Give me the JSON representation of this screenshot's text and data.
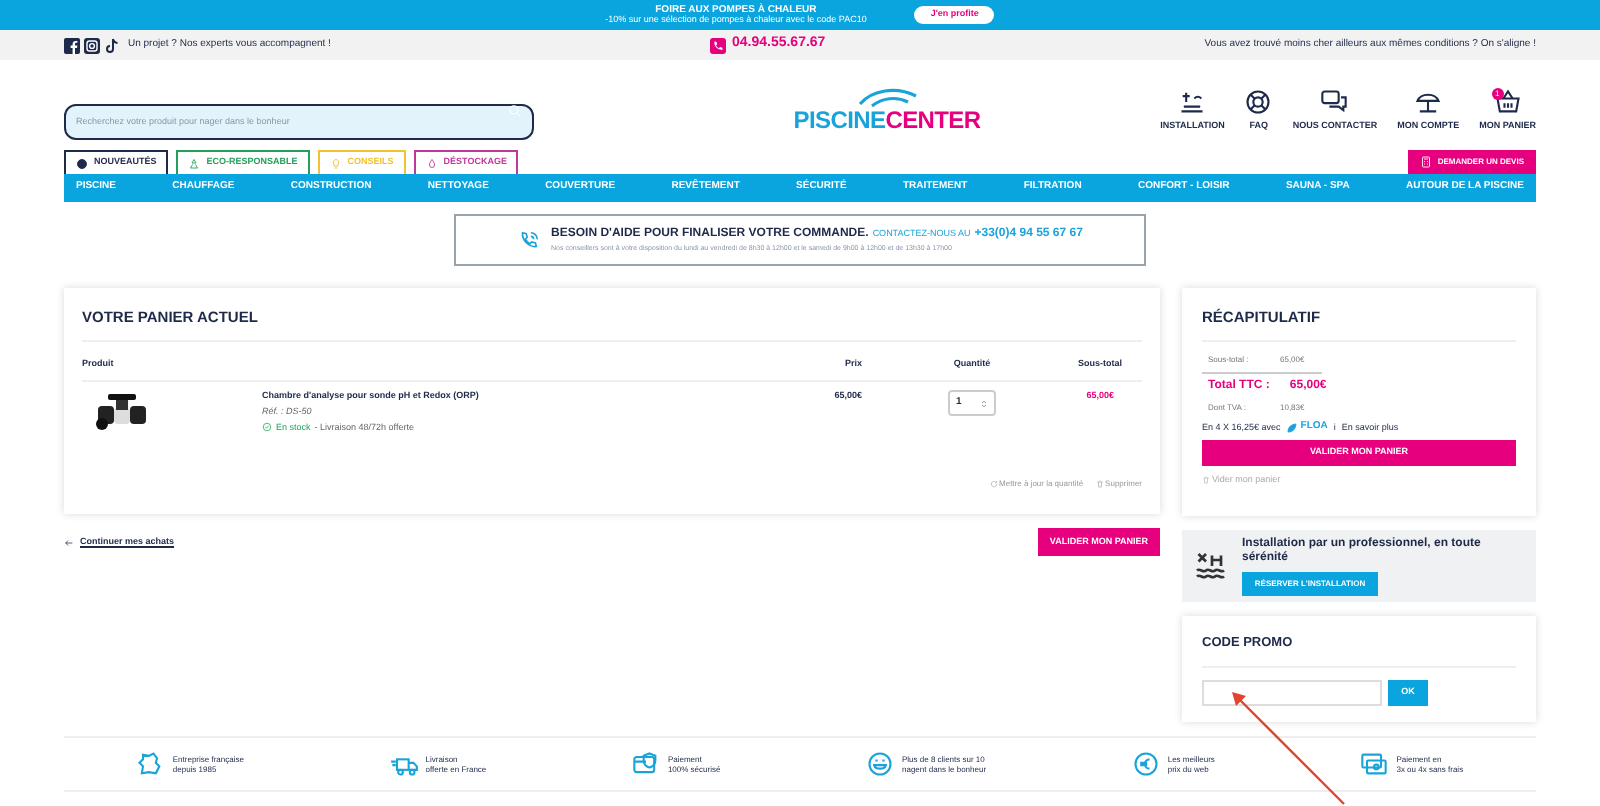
{
  "promo_banner": {
    "title": "FOIRE AUX POMPES À CHALEUR",
    "subtitle": "-10% sur une sélection de pompes à chaleur avec le code PAC10",
    "button": "J'en profite"
  },
  "top_bar": {
    "tagline": "Un projet ? Nos experts vous accompagnent !",
    "phone": "04.94.55.67.67",
    "price_match": "Vous avez trouvé moins cher ailleurs aux mêmes conditions ? On s'aligne !"
  },
  "header": {
    "search_placeholder": "Recherchez votre produit pour nager dans le bonheur",
    "logo": [
      "PISCINE",
      "CENTER"
    ],
    "actions": [
      {
        "kind": "installation",
        "label": "INSTALLATION"
      },
      {
        "kind": "faq",
        "label": "FAQ"
      },
      {
        "kind": "contact",
        "label": "NOUS CONTACTER"
      },
      {
        "kind": "account",
        "label": "MON COMPTE"
      },
      {
        "kind": "cart",
        "label": "MON PANIER",
        "badge": "1"
      }
    ]
  },
  "tabs": [
    {
      "label": "NOUVEAUTÉS",
      "color": "#1e2a4a"
    },
    {
      "label": "ECO-RESPONSABLE",
      "color": "#22a05a"
    },
    {
      "label": "CONSEILS",
      "color": "#f2c230"
    },
    {
      "label": "DÉSTOCKAGE",
      "color": "#c0399a"
    }
  ],
  "quote_button": "DEMANDER UN DEVIS",
  "nav": [
    "PISCINE",
    "CHAUFFAGE",
    "CONSTRUCTION",
    "NETTOYAGE",
    "COUVERTURE",
    "REVÊTEMENT",
    "SÉCURITÉ",
    "TRAITEMENT",
    "FILTRATION",
    "CONFORT - LOISIR",
    "SAUNA - SPA",
    "AUTOUR DE LA PISCINE"
  ],
  "help": {
    "title": "BESOIN D'AIDE POUR FINALISER VOTRE COMMANDE.",
    "contact_label": "CONTACTEZ-NOUS AU",
    "contact_phone": "+33(0)4 94 55 67 67",
    "hours": "Nos conseillers sont à votre disposition du lundi au vendredi de 8h30 à 12h00 et le samedi de 9h00 à 12h00 et de 13h30 à 17h00"
  },
  "cart": {
    "title": "VOTRE PANIER ACTUEL",
    "columns": [
      "Produit",
      "Prix",
      "Quantité",
      "Sous-total"
    ],
    "items": [
      {
        "name": "Chambre d'analyse pour sonde pH et Redox (ORP)",
        "ref": "Réf. : DS-50",
        "stock": "En stock",
        "delivery": "- Livraison 48/72h offerte",
        "price": "65,00€",
        "quantity": "1",
        "subtotal": "65,00€"
      }
    ],
    "update": "Mettre à jour la quantité",
    "delete": "Supprimer"
  },
  "continue_link": "Continuer mes achats",
  "validate_button": "VALIDER MON PANIER",
  "summary": {
    "title": "RÉCAPITULATIF",
    "rows": [
      {
        "kind": "line",
        "label": "Sous-total :",
        "value": "65,00€"
      },
      {
        "kind": "total",
        "label": "Total TTC :",
        "value": "65,00€"
      },
      {
        "kind": "line",
        "label": "Dont TVA :",
        "value": "10,83€"
      }
    ],
    "installments": "En 4 X 16,25€ avec",
    "brand": "FLOA",
    "info": "i",
    "more": "En savoir plus",
    "button": "VALIDER MON PANIER",
    "empty": "Vider mon panier"
  },
  "installation": {
    "title": "Installation par un professionnel, en toute sérénité",
    "button": "RÉSERVER L'INSTALLATION"
  },
  "promo_code": {
    "title": "CODE PROMO",
    "button": "OK"
  },
  "features": [
    {
      "kind": "map",
      "lines": [
        "Entreprise française",
        "depuis 1985"
      ]
    },
    {
      "kind": "truck",
      "lines": [
        "Livraison",
        "offerte en France"
      ]
    },
    {
      "kind": "secure",
      "lines": [
        "Paiement",
        "100% sécurisé"
      ]
    },
    {
      "kind": "smile",
      "lines": [
        "Plus de 8 clients sur 10",
        "nagent dans le bonheur"
      ]
    },
    {
      "kind": "euro",
      "lines": [
        "Les meilleurs",
        "prix du web"
      ]
    },
    {
      "kind": "cards",
      "lines": [
        "Paiement en",
        "3x ou 4x sans frais"
      ]
    }
  ]
}
